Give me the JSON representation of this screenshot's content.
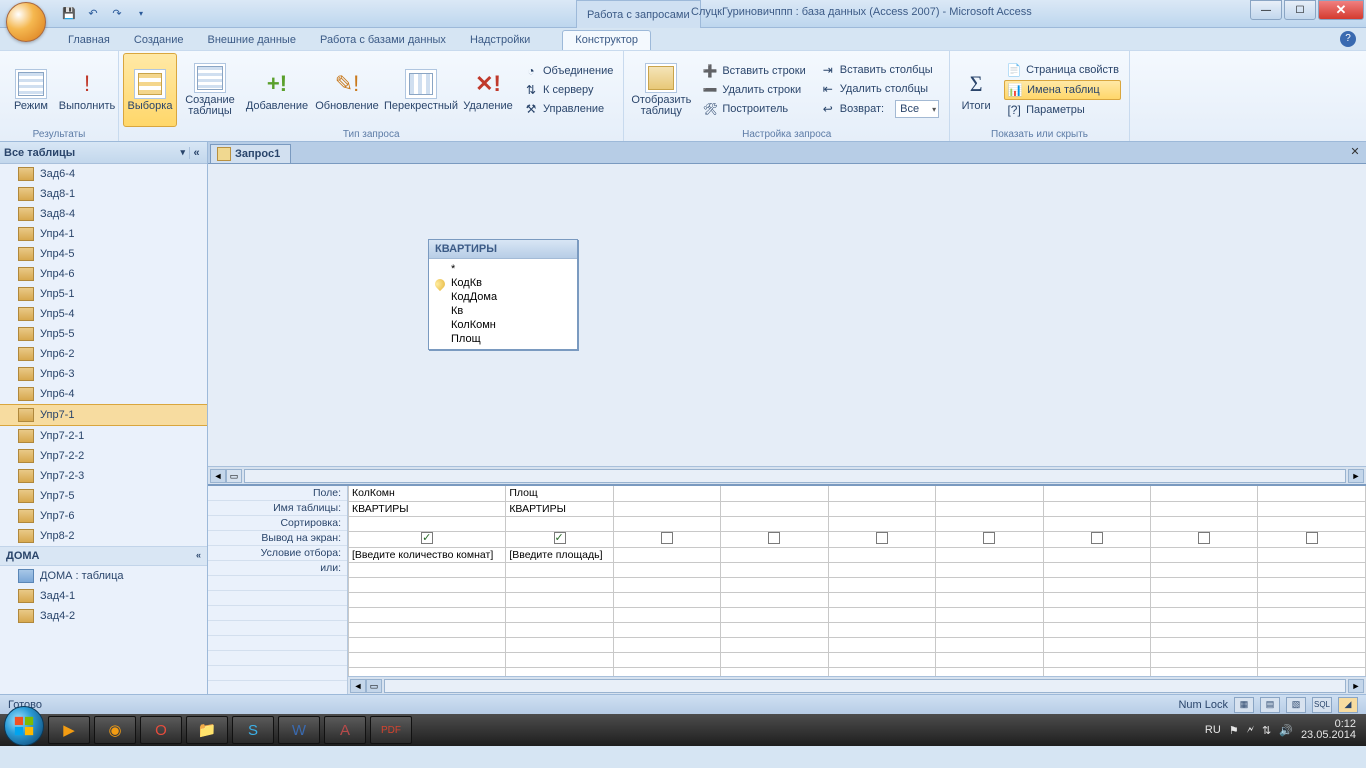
{
  "title_context_tab": "Работа с запросами",
  "title_text": "СлуцкГуриновичппп : база данных (Access 2007) - Microsoft Access",
  "tabs": {
    "home": "Главная",
    "create": "Создание",
    "external": "Внешние данные",
    "dbtools": "Работа с базами данных",
    "addins": "Надстройки",
    "designer": "Конструктор"
  },
  "ribbon": {
    "results": {
      "view": "Режим",
      "run": "Выполнить",
      "label": "Результаты"
    },
    "qtype": {
      "select": "Выборка",
      "maketable": "Создание таблицы",
      "append": "Добавление",
      "update": "Обновление",
      "crosstab": "Перекрестный",
      "delete": "Удаление",
      "union": "Объединение",
      "passthrough": "К серверу",
      "datadef": "Управление",
      "label": "Тип запроса"
    },
    "setup": {
      "showtable": "Отобразить таблицу",
      "insrows": "Вставить строки",
      "delrows": "Удалить строки",
      "builder": "Построитель",
      "inscols": "Вставить столбцы",
      "delcols": "Удалить столбцы",
      "return": "Возврат:",
      "return_val": "Все",
      "label": "Настройка запроса"
    },
    "showhide": {
      "totals": "Итоги",
      "propsheet": "Страница свойств",
      "tablenames": "Имена таблиц",
      "params": "Параметры",
      "label": "Показать или скрыть"
    }
  },
  "nav": {
    "header": "Все таблицы",
    "items": [
      "Зад6-4",
      "Зад8-1",
      "Зад8-4",
      "Упр4-1",
      "Упр4-5",
      "Упр4-6",
      "Упр5-1",
      "Упр5-4",
      "Упр5-5",
      "Упр6-2",
      "Упр6-3",
      "Упр6-4",
      "Упр7-1",
      "Упр7-2-1",
      "Упр7-2-2",
      "Упр7-2-3",
      "Упр7-5",
      "Упр7-6",
      "Упр8-2"
    ],
    "selected": "Упр7-1",
    "group2": "ДОМА",
    "group2_items": [
      "ДОМА : таблица",
      "Зад4-1",
      "Зад4-2"
    ]
  },
  "doc_tab": "Запрос1",
  "tablebox": {
    "title": "КВАРТИРЫ",
    "fields": [
      "*",
      "КодКв",
      "КодДома",
      "Кв",
      "КолКомн",
      "Площ"
    ],
    "key_idx": 1
  },
  "grid": {
    "labels": [
      "Поле:",
      "Имя таблицы:",
      "Сортировка:",
      "Вывод на экран:",
      "Условие отбора:",
      "или:"
    ],
    "cols": [
      {
        "field": "КолКомн",
        "table": "КВАРТИРЫ",
        "show": true,
        "criteria": "[Введите количество комнат]"
      },
      {
        "field": "Площ",
        "table": "КВАРТИРЫ",
        "show": true,
        "criteria": "[Введите площадь]"
      }
    ],
    "extra_cols": 7
  },
  "status": {
    "ready": "Готово",
    "numlock": "Num Lock"
  },
  "tray": {
    "lang": "RU",
    "time": "0:12",
    "date": "23.05.2014"
  }
}
